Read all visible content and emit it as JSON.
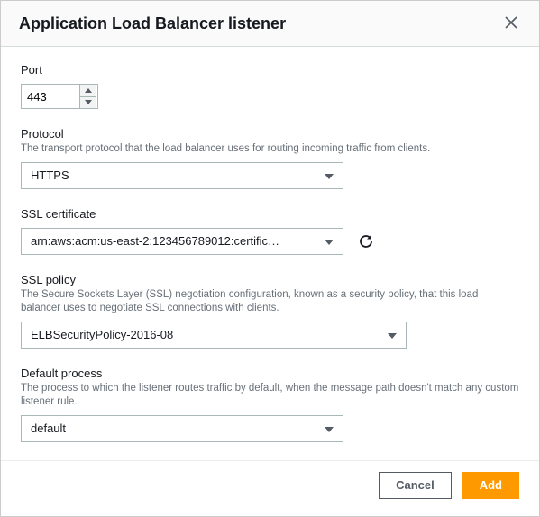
{
  "header": {
    "title": "Application Load Balancer listener"
  },
  "fields": {
    "port": {
      "label": "Port",
      "value": "443"
    },
    "protocol": {
      "label": "Protocol",
      "desc": "The transport protocol that the load balancer uses for routing incoming traffic from clients.",
      "value": "HTTPS"
    },
    "ssl_cert": {
      "label": "SSL certificate",
      "value": "arn:aws:acm:us-east-2:123456789012:certific…"
    },
    "ssl_policy": {
      "label": "SSL policy",
      "desc": "The Secure Sockets Layer (SSL) negotiation configuration, known as a security policy, that this load balancer uses to negotiate SSL connections with clients.",
      "value": "ELBSecurityPolicy-2016-08"
    },
    "default_process": {
      "label": "Default process",
      "desc": "The process to which the listener routes traffic by default, when the message path doesn't match any custom listener rule.",
      "value": "default"
    }
  },
  "footer": {
    "cancel": "Cancel",
    "add": "Add"
  }
}
